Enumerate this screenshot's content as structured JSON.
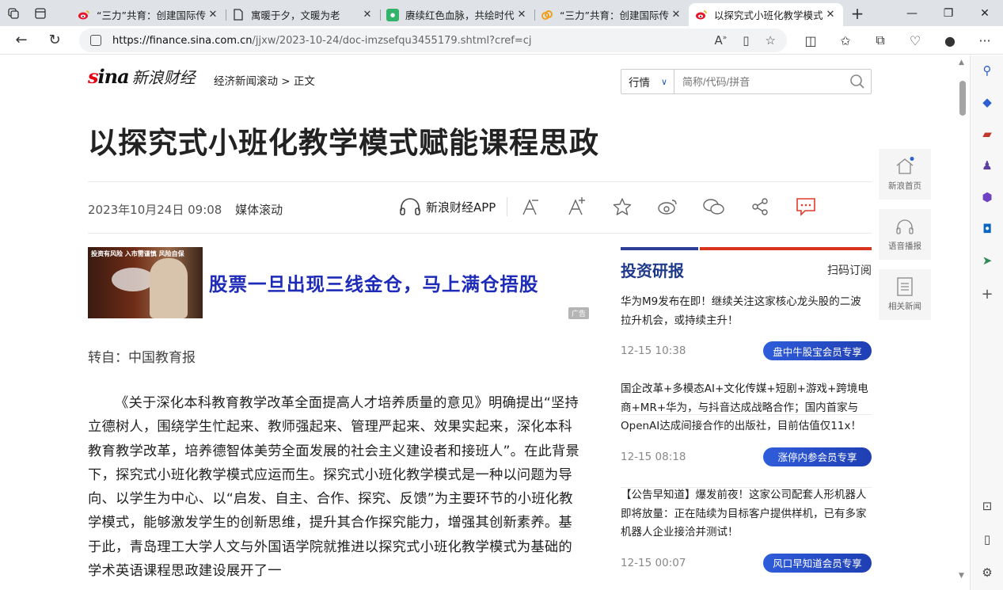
{
  "browser": {
    "tabs": [
      {
        "title": "“三力”共育：创建国际传",
        "favicon": "weibo-icon",
        "active": false
      },
      {
        "title": "寓暖于夕，文暖为老",
        "favicon": "page-icon",
        "active": false
      },
      {
        "title": "赓续红色血脉，共绘时代",
        "favicon": "green-app-icon",
        "active": false
      },
      {
        "title": "“三力”共育：创建国际传",
        "favicon": "link-icon",
        "active": false
      },
      {
        "title": "以探究式小班化教学模式",
        "favicon": "weibo-icon",
        "active": true
      }
    ],
    "url_host": "https://finance.sina.com.cn",
    "url_path": "/jjxw/2023-10-24/doc-imzsefqu3455179.shtml?cref=cj"
  },
  "header": {
    "logo_brand": "sina",
    "logo_sub": "新浪财经",
    "breadcrumb": "经济新闻滚动 > 正文",
    "search_select": "行情",
    "search_placeholder": "简称/代码/拼音"
  },
  "article": {
    "title": "以探究式小班化教学模式赋能课程思政",
    "date": "2023年10月24日 09:08",
    "source": "媒体滚动",
    "app_label": "新浪财经APP",
    "from": "转自：中国教育报",
    "body": "《关于深化本科教育教学改革全面提高人才培养质量的意见》明确提出“坚持立德树人，围绕学生忙起来、教师强起来、管理严起来、效果实起来，深化本科教育教学改革，培养德智体美劳全面发展的社会主义建设者和接班人”。在此背景下，探究式小班化教学模式应运而生。探究式小班化教学模式是一种以问题为导向、以学生为中心、以“启发、自主、合作、探究、反馈”为主要环节的小班化教学模式，能够激发学生的创新思维，提升其合作探究能力，增强其创新素养。基于此，青岛理工大学人文与外国语学院就推进以探究式小班化教学模式为基础的学术英语课程思政建设展开了一"
  },
  "ad": {
    "image_caption": "投资有风险 入市需谨慎 风险自保",
    "text": "股票一旦出现三线金仓，马上满仓捂股",
    "tag": "广告"
  },
  "sidebar": {
    "title": "投资研报",
    "subscribe": "扫码订阅",
    "items": [
      {
        "text": "华为M9发布在即！继续关注这家核心龙头股的二波拉升机会，或持续主升！",
        "time": "12-15 10:38",
        "button": "盘中牛股宝会员专享"
      },
      {
        "text": "国企改革+多模态AI+文化传媒+短剧+游戏+跨境电商+MR+华为，与抖音达成战略合作；国内首家与OpenAI达成间接合作的出版社，目前估值仅11x！",
        "time": "12-15 08:18",
        "button": "涨停内参会员专享"
      },
      {
        "text": "【公告早知道】爆发前夜！这家公司配套人形机器人即将放量：正在陆续为目标客户提供样机，已有多家机器人企业接洽并测试！",
        "time": "12-15 00:07",
        "button": "风口早知道会员专享"
      }
    ]
  },
  "float_tools": [
    {
      "label": "新浪首页",
      "icon": "home-icon"
    },
    {
      "label": "语音播报",
      "icon": "headphones-icon"
    },
    {
      "label": "相关新闻",
      "icon": "document-icon"
    }
  ]
}
